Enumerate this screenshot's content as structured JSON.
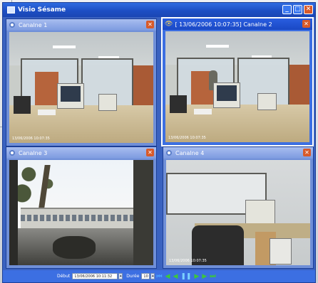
{
  "window": {
    "title": "Visio Sésame"
  },
  "panels": [
    {
      "title": "Canalne 1",
      "timestamp": "13/06/2006 10:07:35"
    },
    {
      "title": "[ 13/06/2006 10:07:35]   Canalne 2",
      "timestamp": "13/06/2006 10:07:35"
    },
    {
      "title": "Canalne 3",
      "timestamp": ""
    },
    {
      "title": "Canalne 4",
      "timestamp": "13/06/2006 10:07:35"
    }
  ],
  "controls": {
    "start_label": "Début",
    "start_value": "13/06/2006 10:11:32",
    "duration_label": "Durée",
    "duration_value": "10"
  },
  "colors": {
    "accent": "#3c6fe2",
    "title_bar": "#1d4fc4",
    "close": "#d85a2a"
  }
}
